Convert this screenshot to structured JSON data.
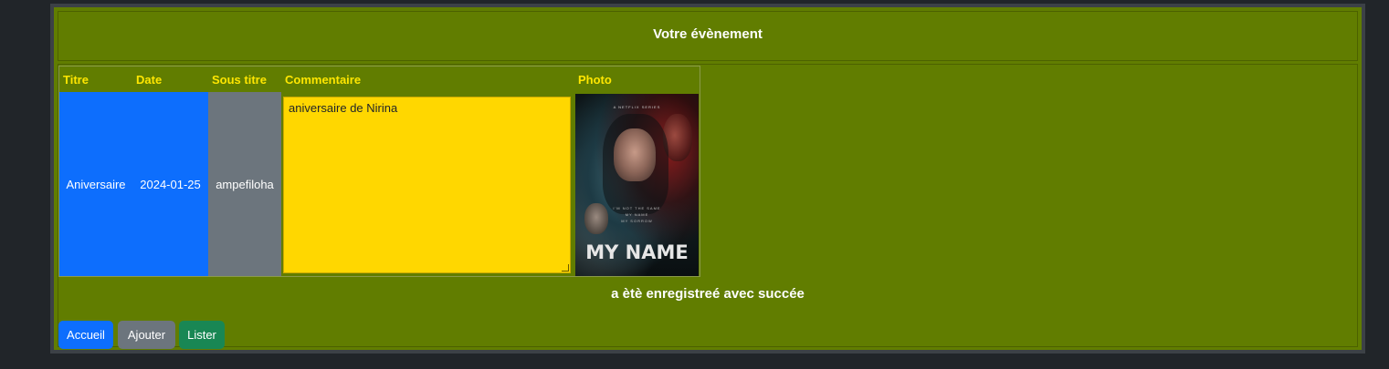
{
  "header": {
    "title": "Votre évènement"
  },
  "table": {
    "headers": [
      "Titre",
      "Date",
      "Sous titre",
      "Commentaire",
      "Photo"
    ],
    "row": {
      "titre": "Aniversaire",
      "date": "2024-01-25",
      "sous_titre": "ampefiloha",
      "commentaire": "aniversaire de Nirina",
      "photo_title": "MY NAME",
      "photo_top_text": "A NETFLIX SERIES",
      "photo_tagline": "I'M NOT THE SAME\nMY NAME\nMY SORROW"
    }
  },
  "message": "a ètè enregistreé avec succée",
  "buttons": {
    "accueil": "Accueil",
    "ajouter": "Ajouter",
    "lister": "Lister"
  },
  "colors": {
    "background": "#212529",
    "panel": "#617d00",
    "header_text": "#ffe600",
    "primary": "#0d6efd",
    "secondary": "#6c757d",
    "success": "#198754",
    "comment_bg": "#ffd700"
  }
}
